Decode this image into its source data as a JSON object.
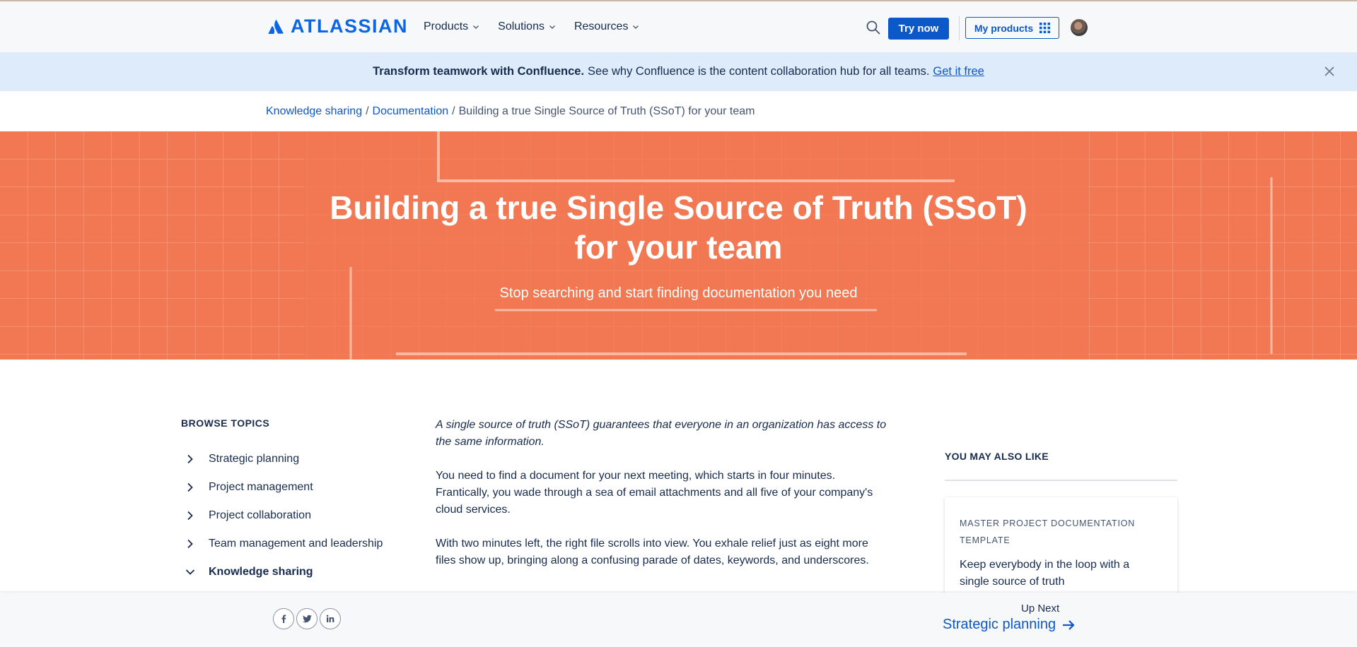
{
  "nav": {
    "brand": "ATLASSIAN",
    "menu": [
      {
        "label": "Products"
      },
      {
        "label": "Solutions"
      },
      {
        "label": "Resources"
      }
    ],
    "try_label": "Try now",
    "my_products_label": "My products",
    "colors": {
      "brand": "#0c66e4",
      "button": "#0c58c8",
      "nav_bg": "#f7f8f9"
    }
  },
  "banner": {
    "bold_text": "Transform teamwork with Confluence.",
    "text": "See why Confluence is the content collaboration hub for all teams.",
    "link_text": "Get it free",
    "bg": "#ddebfb"
  },
  "breadcrumb": {
    "items": [
      "Knowledge sharing",
      "Documentation",
      "Building a true Single Source of Truth (SSoT) for your team"
    ],
    "separator": "/"
  },
  "hero": {
    "title_line1": "Building a true Single Source of Truth (SSoT)",
    "title_line2": "for your team",
    "subtitle": "Stop searching and start finding documentation you need",
    "bg": "#f27853"
  },
  "sidebar": {
    "title": "BROWSE TOPICS",
    "topics": [
      {
        "label": "Strategic planning",
        "icon": "chevron-right-icon"
      },
      {
        "label": "Project management",
        "icon": "chevron-right-icon"
      },
      {
        "label": "Project collaboration",
        "icon": "chevron-right-icon"
      },
      {
        "label": "Team management and leadership",
        "icon": "chevron-right-icon"
      },
      {
        "label": "Knowledge sharing",
        "icon": "chevron-down-icon",
        "active": true
      }
    ]
  },
  "article": {
    "lead_line1": "A single source of truth (SSoT) guarantees that everyone in an organization has access to",
    "lead_line2": "the same information.",
    "p1_line1": "You need to find a document for your next meeting, which starts in four minutes.",
    "p1_line2": "Frantically, you wade through a sea of email attachments and all five of your company's",
    "p1_line3": "cloud services.",
    "p2_line1": "With two minutes left, the right file scrolls into view. You exhale relief just as eight more",
    "p2_line2": "files show up, bringing along a confusing parade of dates, keywords, and underscores."
  },
  "rail": {
    "title": "YOU MAY ALSO LIKE",
    "card": {
      "kicker_line1": "MASTER PROJECT DOCUMENTATION",
      "kicker_line2": "TEMPLATE",
      "title_line1": "Keep everybody in the loop with a",
      "title_line2": "single source of truth"
    }
  },
  "footer": {
    "share": [
      {
        "name": "facebook",
        "glyph": "f"
      },
      {
        "name": "twitter",
        "glyph": "t"
      },
      {
        "name": "linkedin",
        "glyph": "in"
      }
    ],
    "upnext_label": "Up Next",
    "upnext_link": "Strategic planning"
  }
}
